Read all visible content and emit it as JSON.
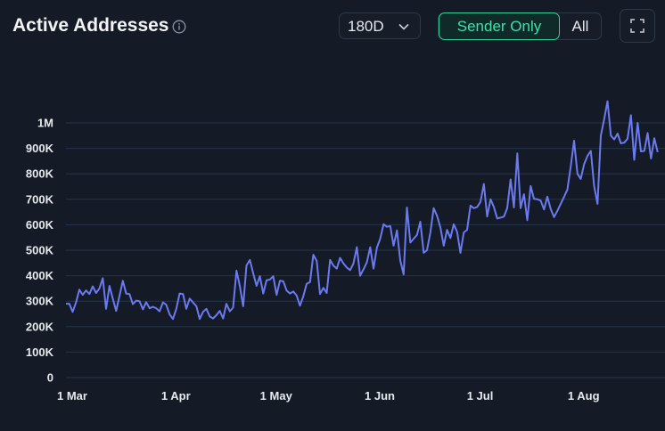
{
  "header": {
    "title": "Active Addresses",
    "range": "180D",
    "toggle": {
      "active": "Sender Only",
      "other": "All"
    }
  },
  "colors": {
    "line": "#6b7af0",
    "grid": "#24344a",
    "accent": "#3fe0a5"
  },
  "icons": [
    "info-icon",
    "chevron-down-icon",
    "expand-icon"
  ],
  "chart_data": {
    "type": "line",
    "title": "",
    "xlabel": "",
    "ylabel": "",
    "ylim": [
      0,
      1000000
    ],
    "y_ticks": [
      {
        "value": 0,
        "label": "0"
      },
      {
        "value": 100000,
        "label": "100K"
      },
      {
        "value": 200000,
        "label": "200K"
      },
      {
        "value": 300000,
        "label": "300K"
      },
      {
        "value": 400000,
        "label": "400K"
      },
      {
        "value": 500000,
        "label": "500K"
      },
      {
        "value": 600000,
        "label": "600K"
      },
      {
        "value": 700000,
        "label": "700K"
      },
      {
        "value": 800000,
        "label": "800K"
      },
      {
        "value": 900000,
        "label": "900K"
      },
      {
        "value": 1000000,
        "label": "1M"
      }
    ],
    "x_ticks": [
      {
        "date": "2024-03-01",
        "label": "1 Mar"
      },
      {
        "date": "2024-04-01",
        "label": "1 Apr"
      },
      {
        "date": "2024-05-01",
        "label": "1 May"
      },
      {
        "date": "2024-06-01",
        "label": "1 Jun"
      },
      {
        "date": "2024-07-01",
        "label": "1 Jul"
      },
      {
        "date": "2024-08-01",
        "label": "1 Aug"
      }
    ],
    "grid": true,
    "legend": "none",
    "series": [
      {
        "values": [
          [
            "2024-03-01",
            290000
          ],
          [
            "2024-03-02",
            290000
          ],
          [
            "2024-03-03",
            258000
          ],
          [
            "2024-03-04",
            295000
          ],
          [
            "2024-03-05",
            345000
          ],
          [
            "2024-03-06",
            325000
          ],
          [
            "2024-03-07",
            342000
          ],
          [
            "2024-03-08",
            328000
          ],
          [
            "2024-03-09",
            358000
          ],
          [
            "2024-03-10",
            332000
          ],
          [
            "2024-03-11",
            350000
          ],
          [
            "2024-03-12",
            390000
          ],
          [
            "2024-03-13",
            270000
          ],
          [
            "2024-03-14",
            360000
          ],
          [
            "2024-03-15",
            310000
          ],
          [
            "2024-03-16",
            262000
          ],
          [
            "2024-03-17",
            320000
          ],
          [
            "2024-03-18",
            380000
          ],
          [
            "2024-03-19",
            330000
          ],
          [
            "2024-03-20",
            328000
          ],
          [
            "2024-03-21",
            288000
          ],
          [
            "2024-03-22",
            302000
          ],
          [
            "2024-03-23",
            300000
          ],
          [
            "2024-03-24",
            268000
          ],
          [
            "2024-03-25",
            296000
          ],
          [
            "2024-03-26",
            272000
          ],
          [
            "2024-03-27",
            278000
          ],
          [
            "2024-03-28",
            272000
          ],
          [
            "2024-03-29",
            260000
          ],
          [
            "2024-03-30",
            295000
          ],
          [
            "2024-03-31",
            286000
          ],
          [
            "2024-04-01",
            248000
          ],
          [
            "2024-04-02",
            230000
          ],
          [
            "2024-04-03",
            270000
          ],
          [
            "2024-04-04",
            330000
          ],
          [
            "2024-04-05",
            328000
          ],
          [
            "2024-04-06",
            270000
          ],
          [
            "2024-04-07",
            310000
          ],
          [
            "2024-04-08",
            295000
          ],
          [
            "2024-04-09",
            280000
          ],
          [
            "2024-04-10",
            230000
          ],
          [
            "2024-04-11",
            258000
          ],
          [
            "2024-04-12",
            270000
          ],
          [
            "2024-04-13",
            240000
          ],
          [
            "2024-04-14",
            232000
          ],
          [
            "2024-04-15",
            245000
          ],
          [
            "2024-04-16",
            262000
          ],
          [
            "2024-04-17",
            232000
          ],
          [
            "2024-04-18",
            290000
          ],
          [
            "2024-04-19",
            260000
          ],
          [
            "2024-04-20",
            275000
          ],
          [
            "2024-04-21",
            420000
          ],
          [
            "2024-04-22",
            360000
          ],
          [
            "2024-04-23",
            280000
          ],
          [
            "2024-04-24",
            440000
          ],
          [
            "2024-04-25",
            462000
          ],
          [
            "2024-04-26",
            410000
          ],
          [
            "2024-04-27",
            360000
          ],
          [
            "2024-04-28",
            398000
          ],
          [
            "2024-04-29",
            330000
          ],
          [
            "2024-04-30",
            382000
          ],
          [
            "2024-05-01",
            385000
          ],
          [
            "2024-05-02",
            398000
          ],
          [
            "2024-05-03",
            325000
          ],
          [
            "2024-05-04",
            380000
          ],
          [
            "2024-05-05",
            378000
          ],
          [
            "2024-05-06",
            342000
          ],
          [
            "2024-05-07",
            330000
          ],
          [
            "2024-05-08",
            338000
          ],
          [
            "2024-05-09",
            322000
          ],
          [
            "2024-05-10",
            282000
          ],
          [
            "2024-05-11",
            320000
          ],
          [
            "2024-05-12",
            368000
          ],
          [
            "2024-05-13",
            375000
          ],
          [
            "2024-05-14",
            482000
          ],
          [
            "2024-05-15",
            458000
          ],
          [
            "2024-05-16",
            328000
          ],
          [
            "2024-05-17",
            352000
          ],
          [
            "2024-05-18",
            332000
          ],
          [
            "2024-05-19",
            462000
          ],
          [
            "2024-05-20",
            440000
          ],
          [
            "2024-05-21",
            428000
          ],
          [
            "2024-05-22",
            470000
          ],
          [
            "2024-05-23",
            448000
          ],
          [
            "2024-05-24",
            432000
          ],
          [
            "2024-05-25",
            422000
          ],
          [
            "2024-05-26",
            448000
          ],
          [
            "2024-05-27",
            512000
          ],
          [
            "2024-05-28",
            400000
          ],
          [
            "2024-05-29",
            425000
          ],
          [
            "2024-05-30",
            452000
          ],
          [
            "2024-05-31",
            512000
          ],
          [
            "2024-06-01",
            428000
          ],
          [
            "2024-06-02",
            510000
          ],
          [
            "2024-06-03",
            545000
          ],
          [
            "2024-06-04",
            602000
          ],
          [
            "2024-06-05",
            592000
          ],
          [
            "2024-06-06",
            595000
          ],
          [
            "2024-06-07",
            518000
          ],
          [
            "2024-06-08",
            578000
          ],
          [
            "2024-06-09",
            460000
          ],
          [
            "2024-06-10",
            405000
          ],
          [
            "2024-06-11",
            668000
          ],
          [
            "2024-06-12",
            530000
          ],
          [
            "2024-06-13",
            545000
          ],
          [
            "2024-06-14",
            560000
          ],
          [
            "2024-06-15",
            612000
          ],
          [
            "2024-06-16",
            490000
          ],
          [
            "2024-06-17",
            500000
          ],
          [
            "2024-06-18",
            570000
          ],
          [
            "2024-06-19",
            665000
          ],
          [
            "2024-06-20",
            635000
          ],
          [
            "2024-06-21",
            590000
          ],
          [
            "2024-06-22",
            518000
          ],
          [
            "2024-06-23",
            580000
          ],
          [
            "2024-06-24",
            548000
          ],
          [
            "2024-06-25",
            602000
          ],
          [
            "2024-06-26",
            572000
          ],
          [
            "2024-06-27",
            490000
          ],
          [
            "2024-06-28",
            570000
          ],
          [
            "2024-06-29",
            580000
          ],
          [
            "2024-06-30",
            675000
          ],
          [
            "2024-07-01",
            665000
          ],
          [
            "2024-07-02",
            670000
          ],
          [
            "2024-07-03",
            690000
          ],
          [
            "2024-07-04",
            760000
          ],
          [
            "2024-07-05",
            632000
          ],
          [
            "2024-07-06",
            700000
          ],
          [
            "2024-07-07",
            670000
          ],
          [
            "2024-07-08",
            625000
          ],
          [
            "2024-07-09",
            628000
          ],
          [
            "2024-07-10",
            632000
          ],
          [
            "2024-07-11",
            665000
          ],
          [
            "2024-07-12",
            778000
          ],
          [
            "2024-07-13",
            668000
          ],
          [
            "2024-07-14",
            880000
          ],
          [
            "2024-07-15",
            665000
          ],
          [
            "2024-07-16",
            720000
          ],
          [
            "2024-07-17",
            618000
          ],
          [
            "2024-07-18",
            752000
          ],
          [
            "2024-07-19",
            702000
          ],
          [
            "2024-07-20",
            700000
          ],
          [
            "2024-07-21",
            695000
          ],
          [
            "2024-07-22",
            660000
          ],
          [
            "2024-07-23",
            710000
          ],
          [
            "2024-07-24",
            662000
          ],
          [
            "2024-07-25",
            630000
          ],
          [
            "2024-07-26",
            655000
          ],
          [
            "2024-07-27",
            682000
          ],
          [
            "2024-07-28",
            710000
          ],
          [
            "2024-07-29",
            738000
          ],
          [
            "2024-07-30",
            830000
          ],
          [
            "2024-07-31",
            930000
          ],
          [
            "2024-08-01",
            800000
          ],
          [
            "2024-08-02",
            780000
          ],
          [
            "2024-08-03",
            838000
          ],
          [
            "2024-08-04",
            870000
          ],
          [
            "2024-08-05",
            890000
          ],
          [
            "2024-08-06",
            752000
          ],
          [
            "2024-08-07",
            682000
          ],
          [
            "2024-08-08",
            950000
          ],
          [
            "2024-08-09",
            1015000
          ],
          [
            "2024-08-10",
            1085000
          ],
          [
            "2024-08-11",
            950000
          ],
          [
            "2024-08-12",
            935000
          ],
          [
            "2024-08-13",
            958000
          ],
          [
            "2024-08-14",
            920000
          ],
          [
            "2024-08-15",
            922000
          ],
          [
            "2024-08-16",
            938000
          ],
          [
            "2024-08-17",
            1030000
          ],
          [
            "2024-08-18",
            855000
          ],
          [
            "2024-08-19",
            1000000
          ],
          [
            "2024-08-20",
            888000
          ],
          [
            "2024-08-21",
            890000
          ],
          [
            "2024-08-22",
            960000
          ],
          [
            "2024-08-23",
            860000
          ],
          [
            "2024-08-24",
            940000
          ],
          [
            "2024-08-25",
            885000
          ]
        ]
      }
    ]
  }
}
